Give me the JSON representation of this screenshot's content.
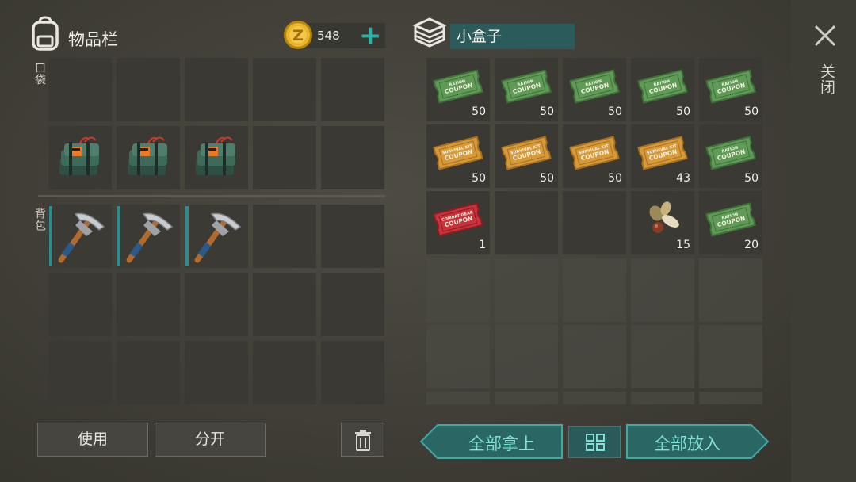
{
  "inventory": {
    "title": "物品栏",
    "pocket_label": "口袋",
    "backpack_label": "背包",
    "pocket_items": [
      "c4-explosive",
      "c4-explosive",
      "c4-explosive"
    ],
    "backpack_items": [
      "pickaxe",
      "pickaxe",
      "pickaxe"
    ]
  },
  "currency": {
    "amount": "548",
    "add_label": "+"
  },
  "container": {
    "title": "小盒子",
    "items": [
      {
        "type": "ration-coupon",
        "count": "50"
      },
      {
        "type": "ration-coupon",
        "count": "50"
      },
      {
        "type": "ration-coupon",
        "count": "50"
      },
      {
        "type": "ration-coupon",
        "count": "50"
      },
      {
        "type": "ration-coupon",
        "count": "50"
      },
      {
        "type": "survival-kit-coupon",
        "count": "50"
      },
      {
        "type": "survival-kit-coupon",
        "count": "50"
      },
      {
        "type": "survival-kit-coupon",
        "count": "50"
      },
      {
        "type": "survival-kit-coupon",
        "count": "43"
      },
      {
        "type": "ration-coupon",
        "count": "50"
      },
      {
        "type": "combat-gear-coupon",
        "count": "1"
      },
      {
        "type": "empty",
        "count": ""
      },
      {
        "type": "empty",
        "count": ""
      },
      {
        "type": "seeds",
        "count": "15"
      },
      {
        "type": "ration-coupon",
        "count": "20"
      }
    ],
    "coupon_texts": {
      "ration": [
        "RATION",
        "COUPON"
      ],
      "survival": [
        "SURVIVAL KIT",
        "COUPON"
      ],
      "combat": [
        "COMBAT GEAR",
        "COUPON"
      ]
    }
  },
  "buttons": {
    "use": "使用",
    "split": "分开",
    "take_all": "全部拿上",
    "put_all": "全部放入",
    "close": "关闭"
  },
  "colors": {
    "accent_teal": "#2e8b8f",
    "ration": "#4f8c4a",
    "survival": "#c98a2e",
    "combat": "#b8272d"
  }
}
